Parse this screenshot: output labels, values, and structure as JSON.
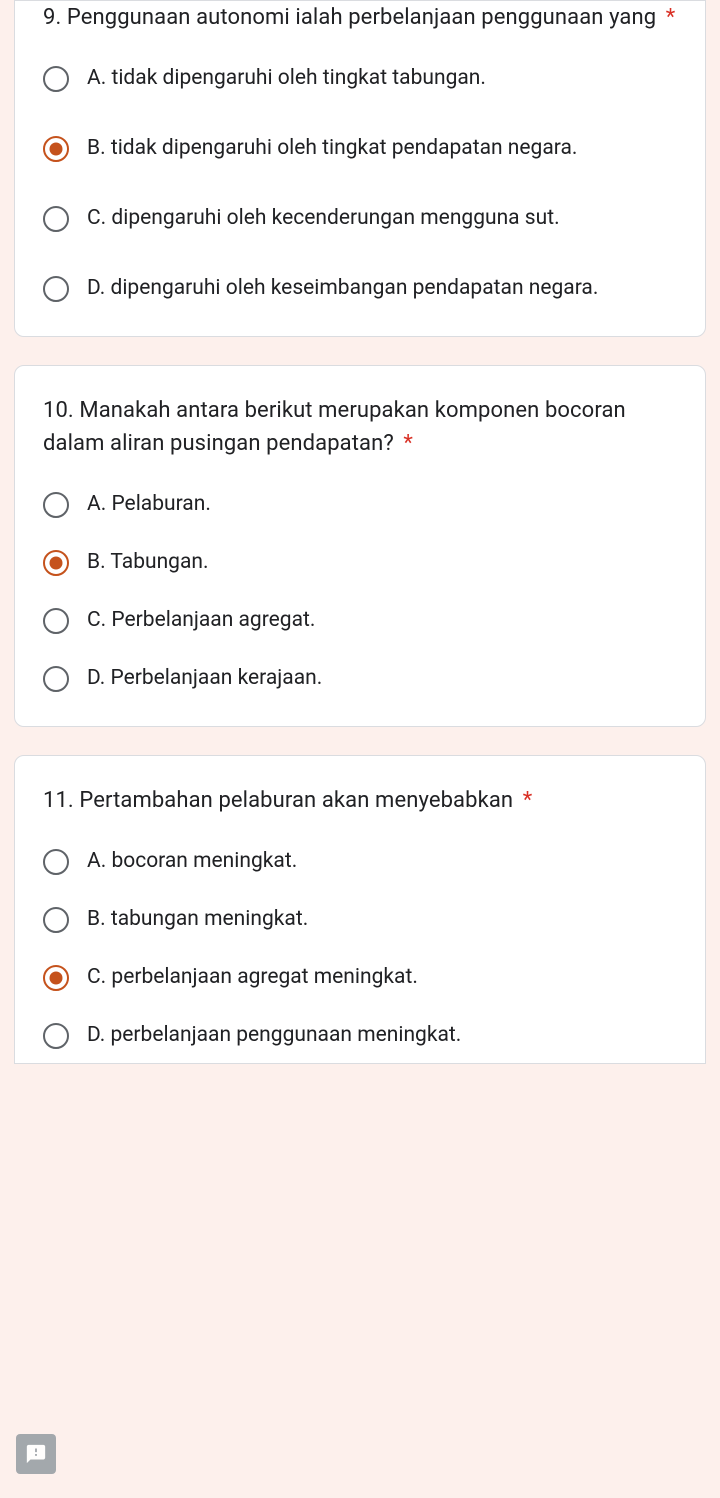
{
  "questions": [
    {
      "title": "9. Penggunaan autonomi ialah perbelanjaan penggunaan yang",
      "required": "*",
      "selectedIndex": 1,
      "options": [
        "A.  tidak dipengaruhi oleh tingkat tabungan.",
        "B.  tidak dipengaruhi oleh tingkat pendapatan negara.",
        "C.  dipengaruhi oleh kecenderungan mengguna sut.",
        "D.  dipengaruhi oleh keseimbangan pendapatan negara."
      ]
    },
    {
      "title": "10. Manakah antara berikut merupakan komponen bocoran dalam aliran pusingan pendapatan?",
      "required": "*",
      "selectedIndex": 1,
      "options": [
        "A.  Pelaburan.",
        "B.  Tabungan.",
        "C.  Perbelanjaan agregat.",
        "D.  Perbelanjaan kerajaan."
      ]
    },
    {
      "title": "11. Pertambahan pelaburan akan menyebabkan",
      "required": "*",
      "selectedIndex": 2,
      "options": [
        "A.  bocoran meningkat.",
        "B.  tabungan meningkat.",
        "C.  perbelanjaan agregat meningkat.",
        "D.  perbelanjaan penggunaan meningkat."
      ]
    }
  ]
}
